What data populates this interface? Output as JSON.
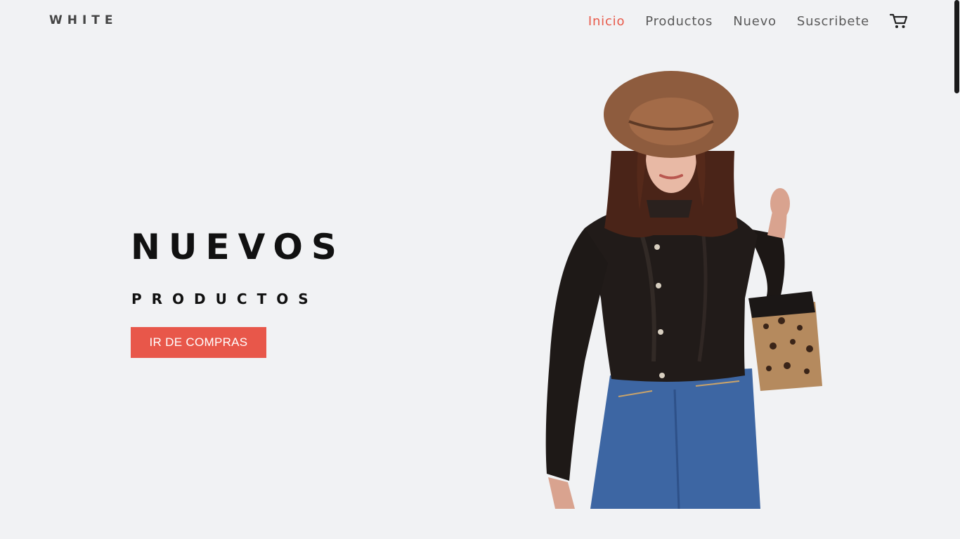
{
  "header": {
    "logo": "WHITE",
    "nav": [
      {
        "label": "Inicio",
        "active": true
      },
      {
        "label": "Productos",
        "active": false
      },
      {
        "label": "Nuevo",
        "active": false
      },
      {
        "label": "Suscribete",
        "active": false
      }
    ],
    "cart_icon": "cart-icon"
  },
  "hero": {
    "title": "NUEVOS",
    "subtitle": "PRODUCTOS",
    "cta_label": "IR DE COMPRAS",
    "image": "model-photo"
  },
  "colors": {
    "accent": "#e8574a",
    "background": "#f1f2f4",
    "text_dark": "#111111",
    "nav_text": "#5a5a5a"
  }
}
